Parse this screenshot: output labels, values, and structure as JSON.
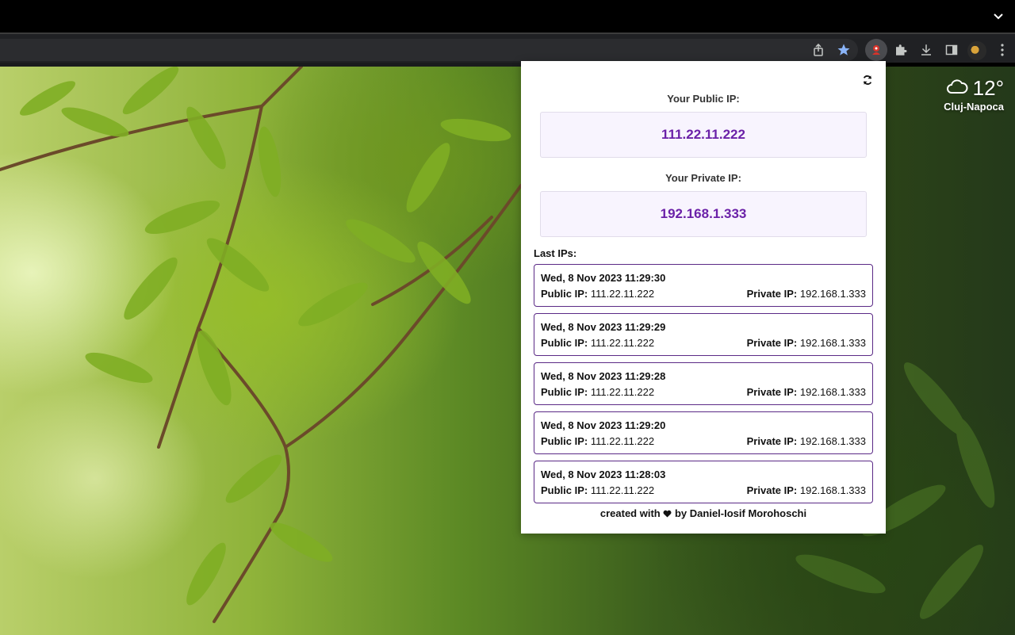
{
  "browser": {
    "toolbar_icons": [
      "share-icon",
      "bookmark-star-icon",
      "extension-ip-icon",
      "puzzle-icon",
      "download-icon",
      "side-panel-icon",
      "profile-avatar",
      "more-menu-icon"
    ],
    "accent": "#8ab4f8"
  },
  "weather": {
    "temperature": "12°",
    "city": "Cluj-Napoca",
    "icon": "cloud-icon"
  },
  "popup": {
    "refresh_icon": "refresh-icon",
    "public_label": "Your Public IP:",
    "public_ip": "111.22.11.222",
    "private_label": "Your Private IP:",
    "private_ip": "192.168.1.333",
    "history_label": "Last IPs:",
    "public_prefix": "Public IP:",
    "private_prefix": "Private IP:",
    "history": [
      {
        "timestamp": "Wed, 8 Nov 2023 11:29:30",
        "public": "111.22.11.222",
        "private": "192.168.1.333"
      },
      {
        "timestamp": "Wed, 8 Nov 2023 11:29:29",
        "public": "111.22.11.222",
        "private": "192.168.1.333"
      },
      {
        "timestamp": "Wed, 8 Nov 2023 11:29:28",
        "public": "111.22.11.222",
        "private": "192.168.1.333"
      },
      {
        "timestamp": "Wed, 8 Nov 2023 11:29:20",
        "public": "111.22.11.222",
        "private": "192.168.1.333"
      },
      {
        "timestamp": "Wed, 8 Nov 2023 11:28:03",
        "public": "111.22.11.222",
        "private": "192.168.1.333"
      }
    ],
    "footer_prefix": "created with",
    "footer_suffix": "by Daniel-Iosif Morohoschi",
    "accent_color": "#6b21a8"
  }
}
